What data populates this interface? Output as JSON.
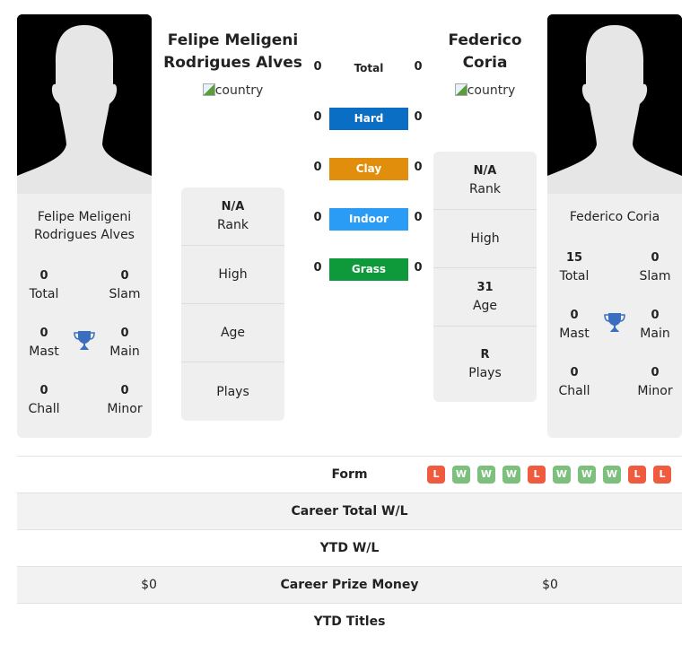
{
  "players": [
    {
      "display_name": "Felipe Meligeni Rodrigues Alves",
      "name_line1": "Felipe Meligeni",
      "name_line2": "Rodrigues Alves",
      "country_alt": "country",
      "stats": {
        "total": "0",
        "slam": "0",
        "mast": "0",
        "main": "0",
        "chall": "0",
        "minor": "0"
      },
      "info": {
        "rank": "N/A",
        "high": "",
        "age": "",
        "plays": ""
      }
    },
    {
      "display_name": "Federico Coria",
      "name_line1": "Federico",
      "name_line2": "Coria",
      "country_alt": "country",
      "stats": {
        "total": "15",
        "slam": "0",
        "mast": "0",
        "main": "0",
        "chall": "0",
        "minor": "0"
      },
      "info": {
        "rank": "N/A",
        "high": "",
        "age": "31",
        "plays": "R"
      }
    }
  ],
  "labels": {
    "total": "Total",
    "slam": "Slam",
    "mast": "Mast",
    "main": "Main",
    "chall": "Chall",
    "minor": "Minor",
    "rank": "Rank",
    "high": "High",
    "age": "Age",
    "plays": "Plays"
  },
  "h2h": [
    {
      "label": "Total",
      "left": "0",
      "right": "0",
      "color": ""
    },
    {
      "label": "Hard",
      "left": "0",
      "right": "0",
      "color": "#0a6ec4"
    },
    {
      "label": "Clay",
      "left": "0",
      "right": "0",
      "color": "#e08e0b"
    },
    {
      "label": "Indoor",
      "left": "0",
      "right": "0",
      "color": "#2b9cf5"
    },
    {
      "label": "Grass",
      "left": "0",
      "right": "0",
      "color": "#0e9a3b"
    }
  ],
  "form": {
    "label": "Form",
    "results": [
      "L",
      "W",
      "W",
      "W",
      "L",
      "W",
      "W",
      "W",
      "L",
      "L"
    ],
    "colors": {
      "W": "#7dbf7d",
      "L": "#ef5b3f"
    }
  },
  "rows": [
    {
      "label": "Career Total W/L",
      "left": "",
      "right": ""
    },
    {
      "label": "YTD W/L",
      "left": "",
      "right": ""
    },
    {
      "label": "Career Prize Money",
      "left": "$0",
      "right": "$0"
    },
    {
      "label": "YTD Titles",
      "left": "",
      "right": ""
    }
  ],
  "accent_trophy": "#3a6fbf"
}
